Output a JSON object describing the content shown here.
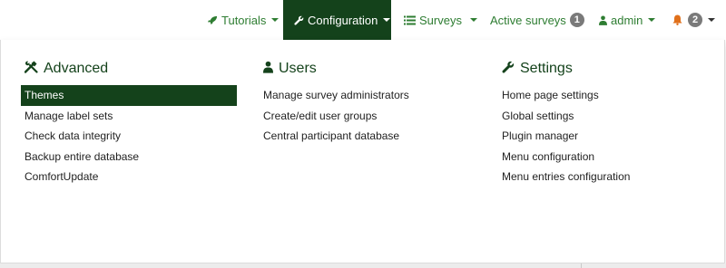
{
  "navbar": {
    "tutorials": {
      "label": "Tutorials",
      "icon": "rocket-icon"
    },
    "configuration": {
      "label": "Configuration",
      "icon": "wrench-icon"
    },
    "surveys": {
      "label": "Surveys",
      "icon": "list-icon"
    },
    "active_surveys": {
      "label": "Active surveys",
      "count": "1"
    },
    "admin": {
      "label": "admin",
      "icon": "user-icon"
    },
    "notifications": {
      "icon": "bell-icon",
      "count": "2"
    }
  },
  "menu": {
    "advanced": {
      "title": "Advanced",
      "icon": "tools-icon",
      "items": [
        "Themes",
        "Manage label sets",
        "Check data integrity",
        "Backup entire database",
        "ComfortUpdate"
      ],
      "selected": "Themes"
    },
    "users": {
      "title": "Users",
      "icon": "user-icon",
      "items": [
        "Manage survey administrators",
        "Create/edit user groups",
        "Central participant database"
      ]
    },
    "settings": {
      "title": "Settings",
      "icon": "wrench-icon",
      "items": [
        "Home page settings",
        "Global settings",
        "Plugin manager",
        "Menu configuration",
        "Menu entries configuration"
      ]
    }
  },
  "colors": {
    "accent_green": "#2e7d32",
    "dark_green": "#14421b",
    "bell_orange": "#e0701b",
    "badge_gray": "#7a7a7a"
  }
}
